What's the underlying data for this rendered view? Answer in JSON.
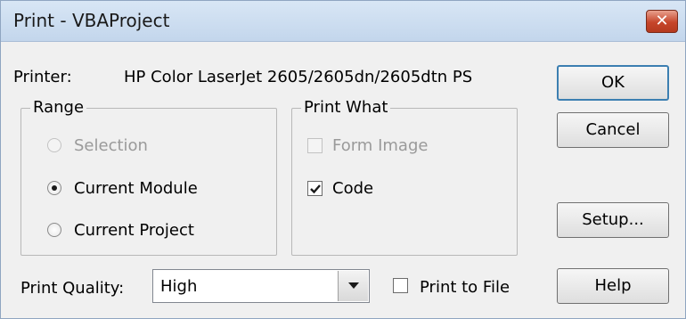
{
  "window": {
    "title": "Print - VBAProject",
    "close_glyph": "✕"
  },
  "printer": {
    "label": "Printer:",
    "name": "HP Color LaserJet 2605/2605dn/2605dtn PS"
  },
  "range": {
    "legend": "Range",
    "options": [
      {
        "label": "Selection",
        "selected": false,
        "enabled": false
      },
      {
        "label": "Current Module",
        "selected": true,
        "enabled": true
      },
      {
        "label": "Current Project",
        "selected": false,
        "enabled": true
      }
    ]
  },
  "print_what": {
    "legend": "Print What",
    "options": [
      {
        "label": "Form Image",
        "checked": false,
        "enabled": false
      },
      {
        "label": "Code",
        "checked": true,
        "enabled": true
      }
    ]
  },
  "print_quality": {
    "label": "Print Quality:",
    "value": "High"
  },
  "print_to_file": {
    "label": "Print to File",
    "checked": false
  },
  "buttons": {
    "ok": "OK",
    "cancel": "Cancel",
    "setup": "Setup...",
    "help": "Help"
  },
  "colors": {
    "title_bar": "#c3d6ec",
    "close_button": "#c6452a",
    "dialog_bg": "#f0f0f0",
    "default_button_border": "#3c7fb1"
  },
  "icons": {
    "close": "close-icon",
    "dropdown": "chevron-down-icon",
    "checkmark": "checkmark-icon"
  }
}
